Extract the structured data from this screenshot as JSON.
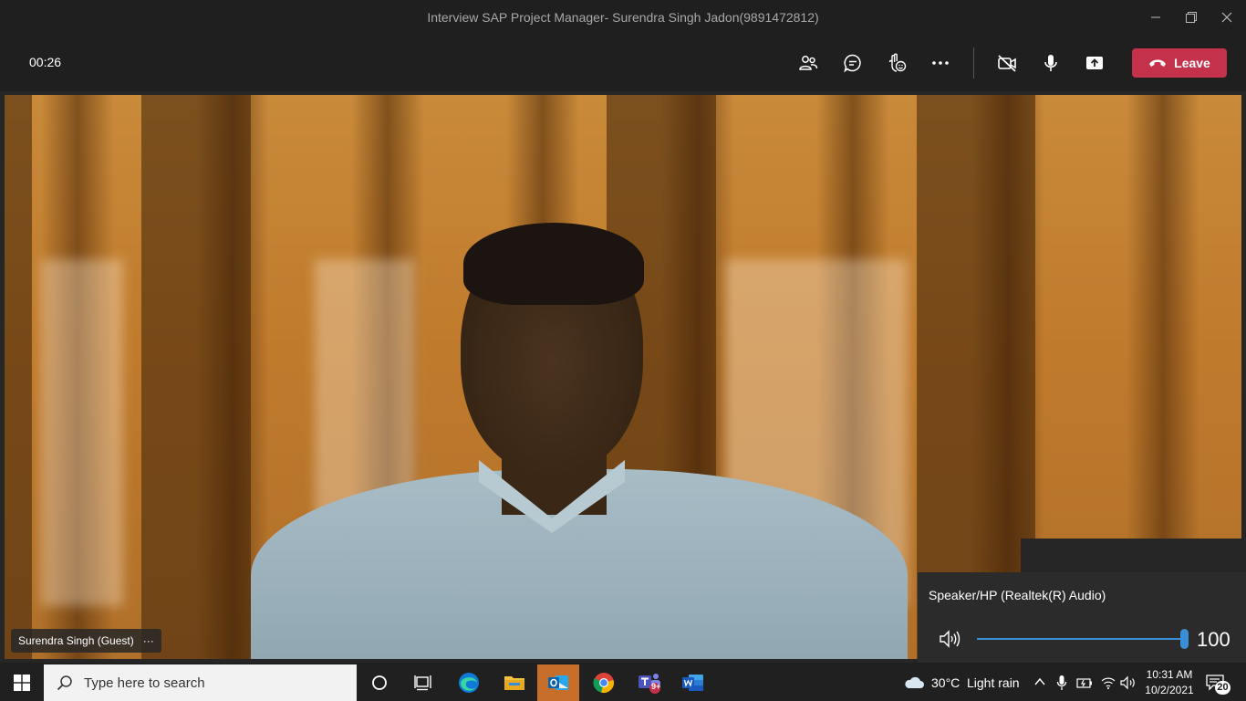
{
  "window": {
    "title": "Interview SAP Project Manager- Surendra Singh Jadon(9891472812)",
    "controls": [
      "minimize",
      "maximize",
      "close"
    ]
  },
  "toolbar": {
    "timer": "00:26",
    "buttons": [
      "people-icon",
      "chat-icon",
      "reactions-icon",
      "more-icon",
      "camera-off-icon",
      "mic-icon",
      "share-icon"
    ],
    "leave_label": "Leave"
  },
  "video": {
    "participant_label": "Surendra Singh (Guest)",
    "more_glyph": "···"
  },
  "volume_flyout": {
    "device": "Speaker/HP (Realtek(R) Audio)",
    "level": "100",
    "level_fraction": 1.0,
    "accent": "#3a8ed8"
  },
  "taskbar": {
    "search_placeholder": "Type here to search",
    "weather_temp": "30°C",
    "weather_desc": "Light rain",
    "time": "10:31 AM",
    "date": "10/2/2021",
    "notifications": "20",
    "teams_badge": "9+"
  },
  "colors": {
    "leave_button": "#c4314b",
    "background": "#1f1f1f",
    "active_app": "#c76e2a"
  }
}
